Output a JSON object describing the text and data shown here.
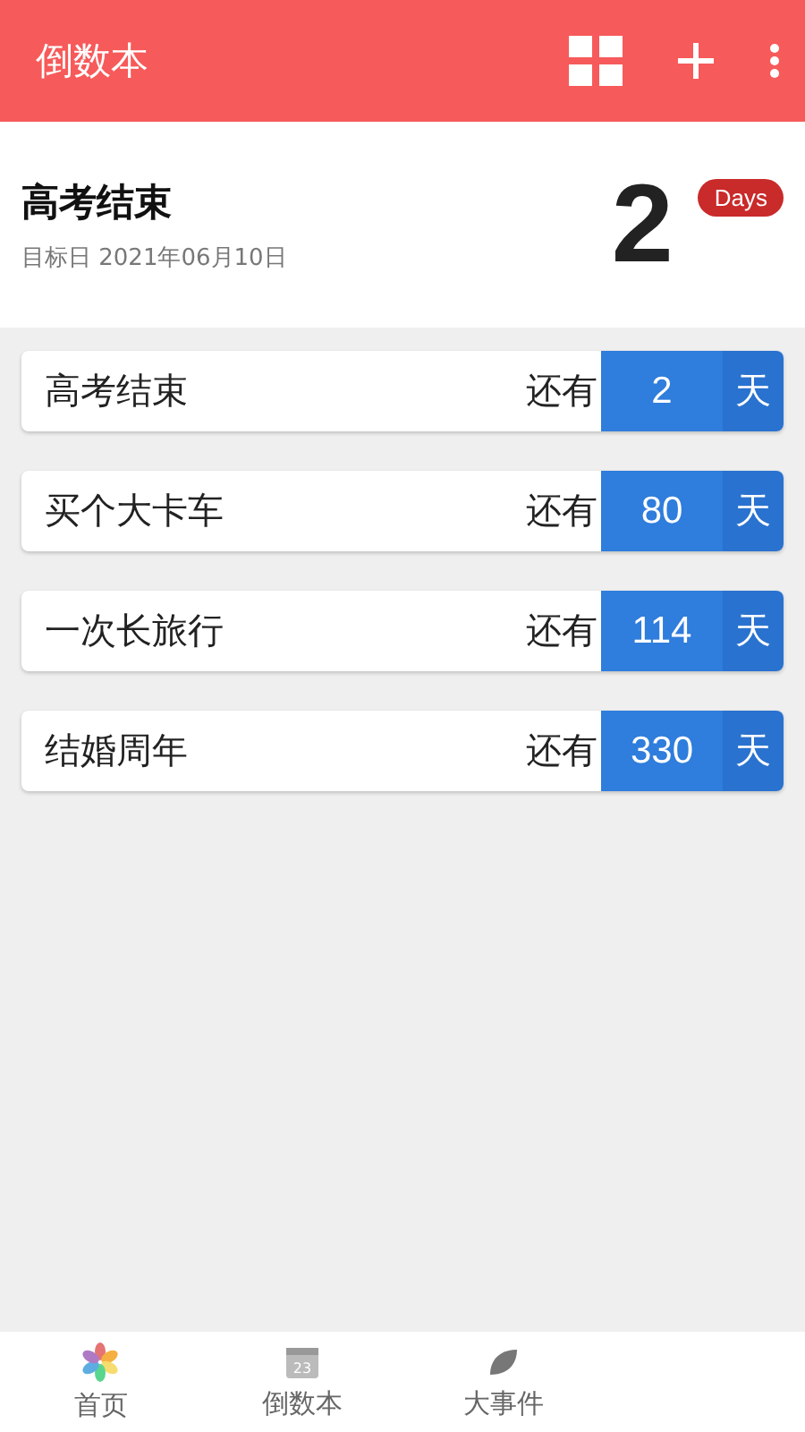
{
  "app_bar": {
    "title": "倒数本"
  },
  "featured": {
    "title": "高考结束",
    "target_date": "目标日 2021年06月10日",
    "days": "2",
    "unit_badge": "Days"
  },
  "events": [
    {
      "name": "高考结束",
      "prefix": "还有",
      "days": "2",
      "unit": "天"
    },
    {
      "name": "买个大卡车",
      "prefix": "还有",
      "days": "80",
      "unit": "天"
    },
    {
      "name": "一次长旅行",
      "prefix": "还有",
      "days": "114",
      "unit": "天"
    },
    {
      "name": "结婚周年",
      "prefix": "还有",
      "days": "330",
      "unit": "天"
    }
  ],
  "bottom_nav": [
    {
      "kind": "home",
      "label": "首页"
    },
    {
      "kind": "calendar",
      "label": "倒数本",
      "icon_text": "23"
    },
    {
      "kind": "leaf",
      "label": "大事件"
    }
  ]
}
